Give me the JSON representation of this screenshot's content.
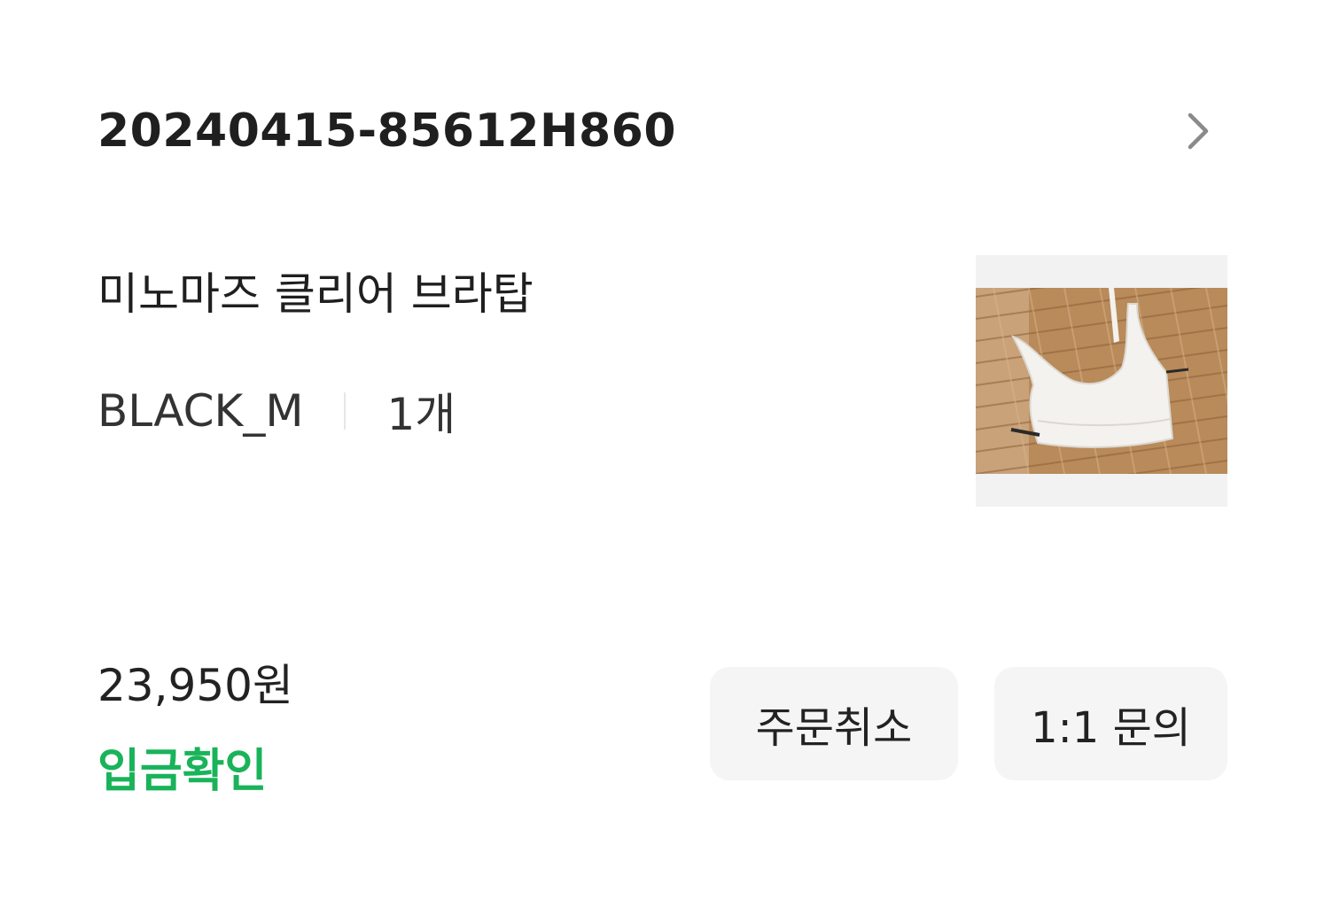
{
  "order": {
    "number": "20240415-85612H860",
    "chevron_icon": "chevron-right-icon"
  },
  "product": {
    "name": "미노마즈 클리어 브라탑",
    "option": "BLACK_M",
    "quantity": "1개",
    "thumbnail_icon": "product-photo"
  },
  "price": "23,950원",
  "status": {
    "label": "입금확인",
    "color": "#19b35a"
  },
  "actions": {
    "cancel_label": "주문취소",
    "inquiry_label": "1:1 문의"
  }
}
